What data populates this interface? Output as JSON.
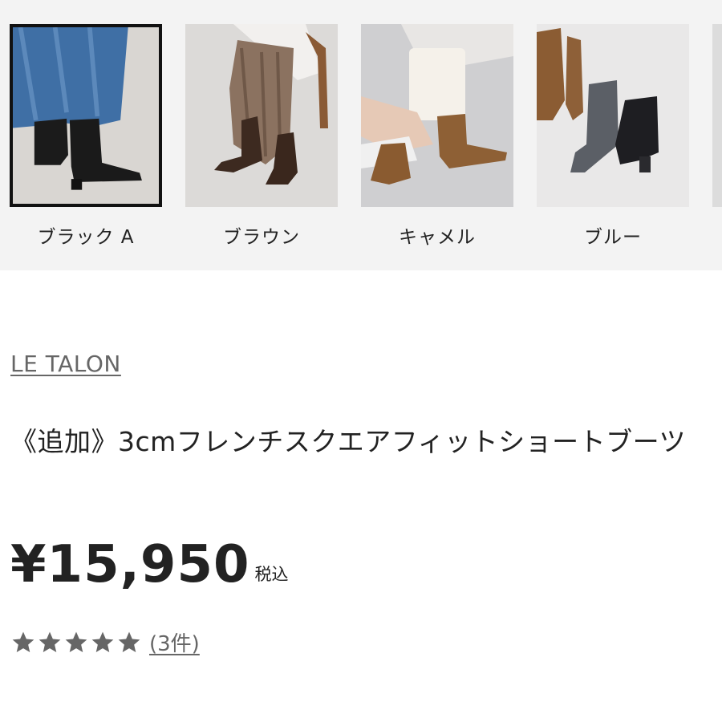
{
  "variants": [
    {
      "label": "ブラック A",
      "selected": true
    },
    {
      "label": "ブラウン",
      "selected": false
    },
    {
      "label": "キャメル",
      "selected": false
    },
    {
      "label": "ブルー",
      "selected": false
    }
  ],
  "product": {
    "brand": "LE TALON",
    "title": "《追加》3cmフレンチスクエアフィットショートブーツ",
    "price": "¥15,950",
    "tax_label": "税込",
    "rating_stars": 5,
    "review_count": "(3件)"
  },
  "colors": {
    "strip_bg": "#f3f3f3",
    "star": "#666666",
    "selected_border": "#111111"
  }
}
